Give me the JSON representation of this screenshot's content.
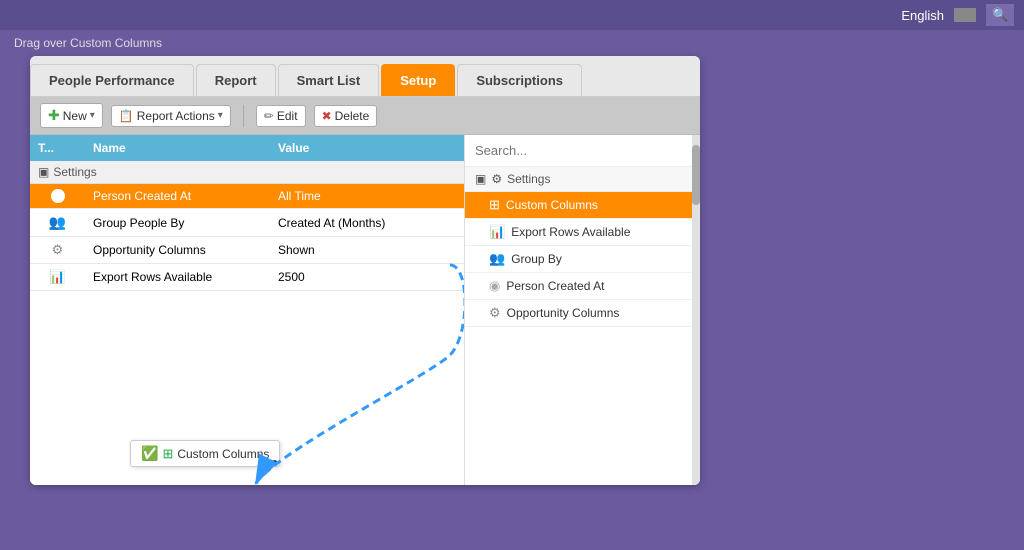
{
  "topbar": {
    "language": "English",
    "search_icon": "🔍"
  },
  "breadcrumb": "Drag over Custom Columns",
  "tabs": [
    {
      "id": "people-performance",
      "label": "People Performance",
      "active": false
    },
    {
      "id": "report",
      "label": "Report",
      "active": false
    },
    {
      "id": "smart-list",
      "label": "Smart List",
      "active": false
    },
    {
      "id": "setup",
      "label": "Setup",
      "active": true
    },
    {
      "id": "subscriptions",
      "label": "Subscriptions",
      "active": false
    }
  ],
  "toolbar": {
    "new_label": "New",
    "report_actions_label": "Report Actions",
    "edit_label": "Edit",
    "delete_label": "Delete"
  },
  "table": {
    "headers": {
      "type": "T...",
      "name": "Name",
      "value": "Value"
    },
    "section": "Settings",
    "rows": [
      {
        "id": "person-created-at",
        "type": "circle-blue",
        "name": "Person Created At",
        "value": "All Time",
        "selected": true
      },
      {
        "id": "group-people-by",
        "type": "people",
        "name": "Group People By",
        "value": "Created At (Months)",
        "selected": false
      },
      {
        "id": "opportunity-columns",
        "type": "gear",
        "name": "Opportunity Columns",
        "value": "Shown",
        "selected": false
      },
      {
        "id": "export-rows",
        "type": "excel",
        "name": "Export Rows Available",
        "value": "2500",
        "selected": false
      }
    ]
  },
  "drag_item": {
    "label": "Custom Columns"
  },
  "right_panel": {
    "search_placeholder": "Search...",
    "section": "Settings",
    "items": [
      {
        "id": "custom-columns",
        "icon": "grid",
        "label": "Custom Columns",
        "active": true
      },
      {
        "id": "export-rows",
        "icon": "excel",
        "label": "Export Rows Available",
        "active": false
      },
      {
        "id": "group-by",
        "icon": "people",
        "label": "Group By",
        "active": false
      },
      {
        "id": "person-created-at",
        "icon": "circle",
        "label": "Person Created At",
        "active": false
      },
      {
        "id": "opportunity-columns",
        "icon": "gear",
        "label": "Opportunity Columns",
        "active": false
      }
    ]
  }
}
